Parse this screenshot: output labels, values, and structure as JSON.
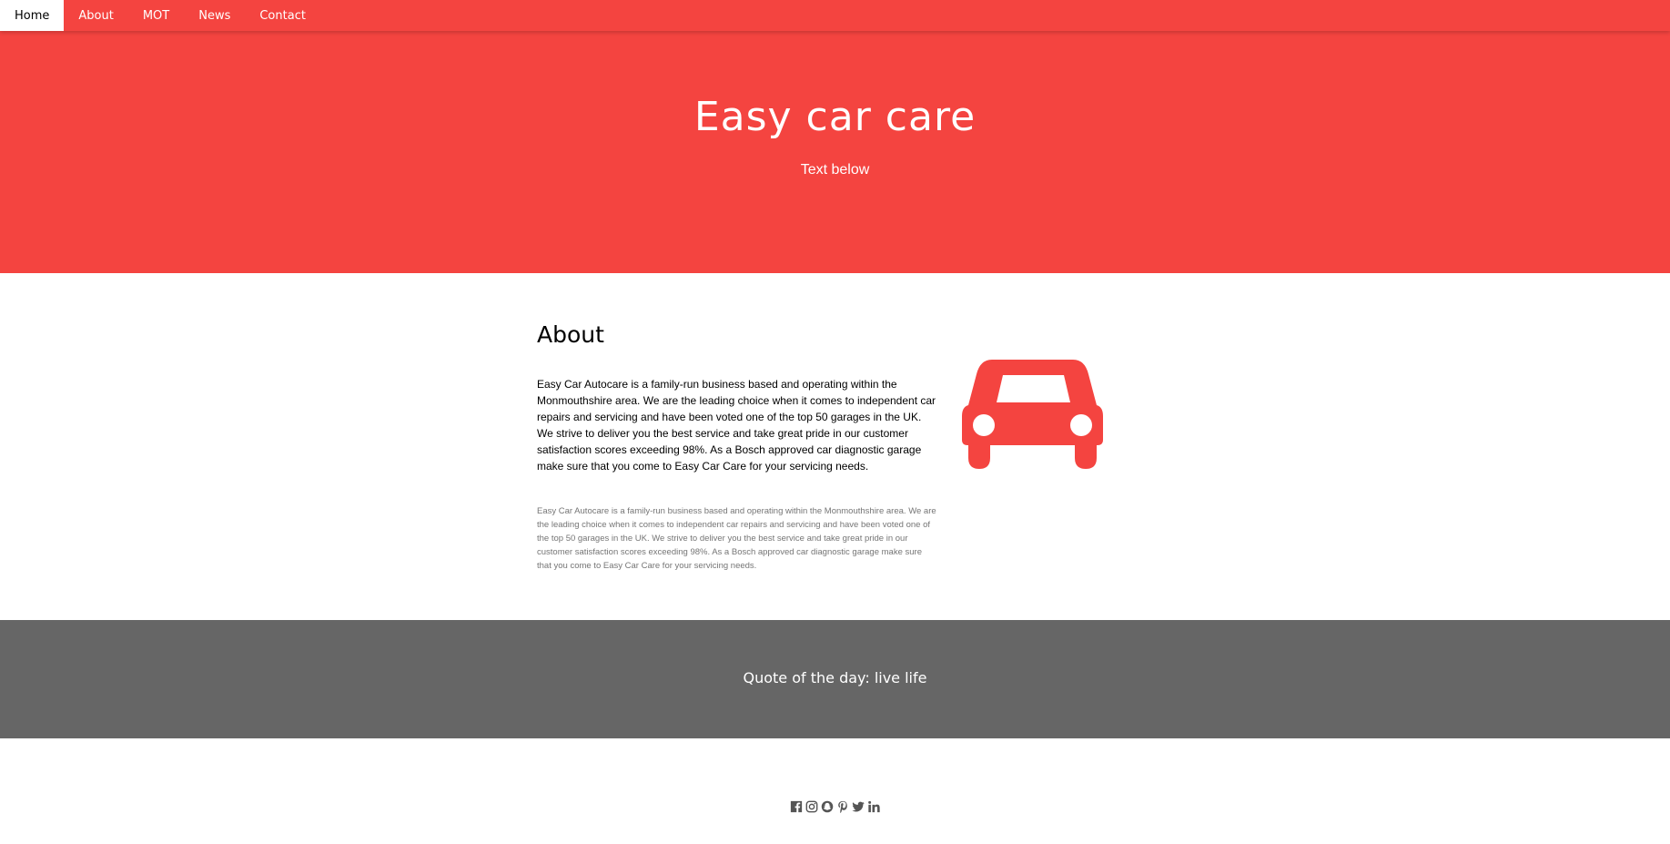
{
  "nav": {
    "items": [
      {
        "label": "Home",
        "active": true
      },
      {
        "label": "About",
        "active": false
      },
      {
        "label": "MOT",
        "active": false
      },
      {
        "label": "News",
        "active": false
      },
      {
        "label": "Contact",
        "active": false
      }
    ]
  },
  "hero": {
    "title": "Easy car care",
    "subtitle": "Text below"
  },
  "about": {
    "heading": "About",
    "paragraph": "Easy Car Autocare is a family-run business based and operating within the Monmouthshire area. We are the leading choice when it comes to independent car repairs and servicing and have been voted one of the top 50 garages in the UK. We strive to deliver you the best service and take great pride in our customer satisfaction scores exceeding 98%. As a Bosch approved car diagnostic garage make sure that you come to Easy Car Care for your servicing needs.",
    "paragraph_small": "Easy Car Autocare is a family-run business based and operating within the Monmouthshire area. We are the leading choice when it comes to independent car repairs and servicing and have been voted one of the top 50 garages in the UK. We strive to deliver you the best service and take great pride in our customer satisfaction scores exceeding 98%. As a Bosch approved car diagnostic garage make sure that you come to Easy Car Care for your servicing needs.",
    "icon": "car-icon"
  },
  "quote": {
    "text": "Quote of the day: live life"
  },
  "footer": {
    "social_icons": [
      "facebook-icon",
      "instagram-icon",
      "snapchat-icon",
      "pinterest-icon",
      "twitter-icon",
      "linkedin-icon"
    ]
  },
  "colors": {
    "brand": "#f44440",
    "quote_bg": "#666666",
    "icon_gray": "#555555",
    "muted_text": "#757575"
  }
}
